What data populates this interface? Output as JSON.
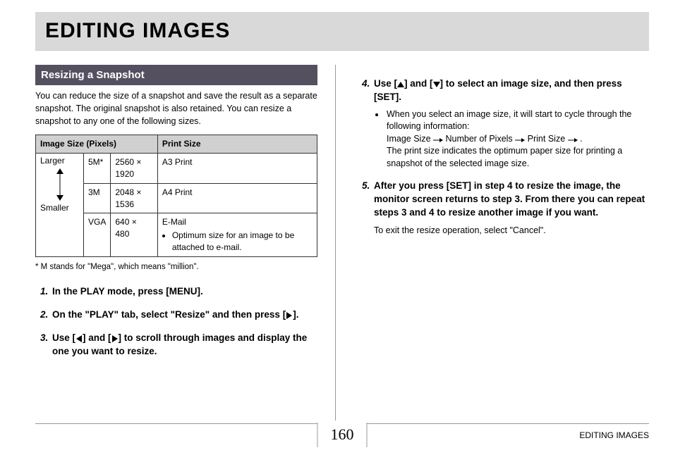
{
  "title": "EDITING IMAGES",
  "section": "Resizing a Snapshot",
  "intro": "You can reduce the size of a snapshot and save the result as a separate snapshot. The original snapshot is also retained. You can resize a snapshot to any one of the following sizes.",
  "table": {
    "header1": "Image Size (Pixels)",
    "header2": "Print Size",
    "larger": "Larger",
    "smaller": "Smaller",
    "rows": [
      {
        "code": "5M*",
        "pixels": "2560 × 1920",
        "print": "A3 Print"
      },
      {
        "code": "3M",
        "pixels": "2048 × 1536",
        "print": "A4 Print"
      },
      {
        "code": "VGA",
        "pixels": "640 × 480",
        "print": "E-Mail",
        "extra": "Optimum size for an image to be attached to e-mail."
      }
    ]
  },
  "note": "*  M stands for \"Mega\", which means \"million\".",
  "steps_left": {
    "s1": "In the PLAY mode, press [MENU].",
    "s2_a": "On the \"PLAY\" tab, select \"Resize\" and then press [",
    "s2_b": "].",
    "s3_a": "Use [",
    "s3_b": "] and [",
    "s3_c": "] to scroll through images and display the one you want to resize."
  },
  "steps_right": {
    "s4_a": "Use [",
    "s4_b": "] and [",
    "s4_c": "] to select an image size, and then press [SET].",
    "s4_sub_intro": "When you select an image size, it will start to cycle through the following information:",
    "s4_chain_1": "Image Size",
    "s4_chain_2": "Number of Pixels",
    "s4_chain_3": "Print Size",
    "s4_chain_4": ".",
    "s4_sub_out": "The print size indicates the optimum paper size for printing a snapshot of the selected image size.",
    "s5": "After you press [SET] in step 4 to resize the image, the monitor screen returns to step 3. From there you can repeat steps 3 and 4 to resize another image if you want.",
    "s5_sub": "To exit the resize operation, select \"Cancel\"."
  },
  "footer": {
    "label": "EDITING IMAGES",
    "page": "160"
  }
}
